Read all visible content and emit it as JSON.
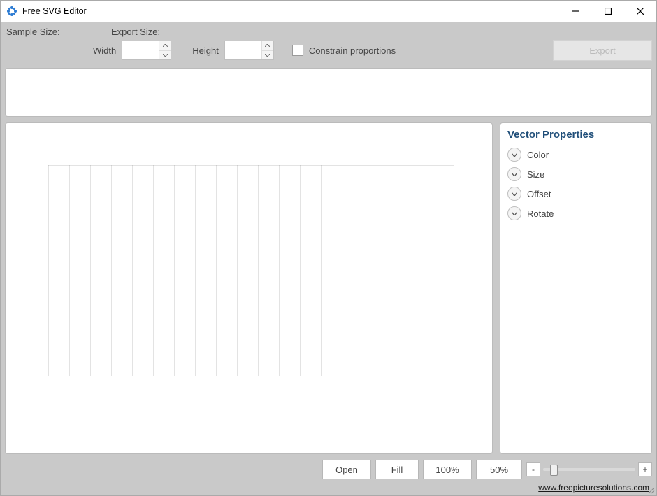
{
  "titlebar": {
    "title": "Free SVG Editor"
  },
  "toolbar": {
    "sample_label": "Sample Size:",
    "export_label": "Export Size:",
    "width_label": "Width",
    "height_label": "Height",
    "constrain_label": "Constrain proportions",
    "export_button": "Export",
    "width_value": "",
    "height_value": ""
  },
  "side": {
    "heading": "Vector Properties",
    "items": [
      {
        "label": "Color"
      },
      {
        "label": "Size"
      },
      {
        "label": "Offset"
      },
      {
        "label": "Rotate"
      }
    ]
  },
  "bottom": {
    "open": "Open",
    "fill": "Fill",
    "p100": "100%",
    "p50": "50%",
    "minus": "-",
    "plus": "+"
  },
  "footer": {
    "link_text": "www.freepicturesolutions.com"
  }
}
